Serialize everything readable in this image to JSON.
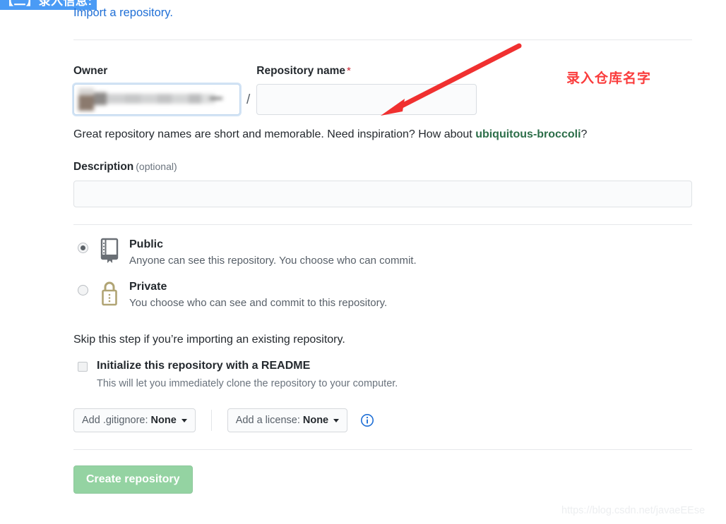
{
  "annotations": {
    "top_banner": "【二】录入信息:",
    "arrow_note": "录入仓库名字",
    "note_color": "#fa3c3c",
    "banner_bg": "#4a9bf5"
  },
  "header": {
    "import_link": "Import a repository."
  },
  "owner": {
    "label": "Owner",
    "value": "",
    "separator": "/"
  },
  "repository_name": {
    "label": "Repository name",
    "required_marker": "*",
    "value": "",
    "placeholder": ""
  },
  "name_help": {
    "prefix": "Great repository names are short and memorable. Need inspiration? How about ",
    "suggestion": "ubiquitous-broccoli",
    "suffix": "?"
  },
  "description": {
    "label": "Description",
    "optional": "(optional)",
    "value": "",
    "placeholder": ""
  },
  "visibility": {
    "options": [
      {
        "id": "public",
        "title": "Public",
        "description": "Anyone can see this repository. You choose who can commit.",
        "icon": "repo-book-icon",
        "selected": true
      },
      {
        "id": "private",
        "title": "Private",
        "description": "You choose who can see and commit to this repository.",
        "icon": "lock-icon",
        "selected": false
      }
    ]
  },
  "initialize": {
    "skip_text": "Skip this step if you’re importing an existing repository.",
    "checkbox_label": "Initialize this repository with a README",
    "checkbox_help": "This will let you immediately clone the repository to your computer.",
    "checked": false
  },
  "dropdowns": {
    "gitignore": {
      "prefix": "Add .gitignore:",
      "value": "None"
    },
    "license": {
      "prefix": "Add a license:",
      "value": "None"
    },
    "info_icon": "info-circle-icon"
  },
  "submit": {
    "label": "Create repository",
    "color": "#94d3a2"
  },
  "watermark": {
    "text": "https://blog.csdn.net/javaeEEse"
  }
}
